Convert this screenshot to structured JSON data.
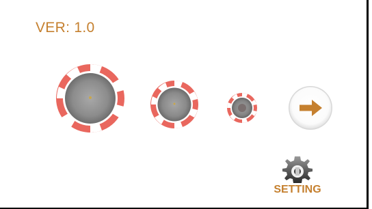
{
  "header": {
    "version_text": "VER: 1.0"
  },
  "chips": [
    {
      "name": "large-chip",
      "size": "large"
    },
    {
      "name": "medium-chip",
      "size": "medium"
    },
    {
      "name": "small-chip",
      "size": "small"
    }
  ],
  "controls": {
    "next_icon": "arrow-right-icon",
    "setting_icon": "gear-icon",
    "setting_label": "SETTING"
  },
  "colors": {
    "accent": "#c5802f",
    "chip_red": "#e9675e",
    "chip_center": "#9a9a9a"
  }
}
